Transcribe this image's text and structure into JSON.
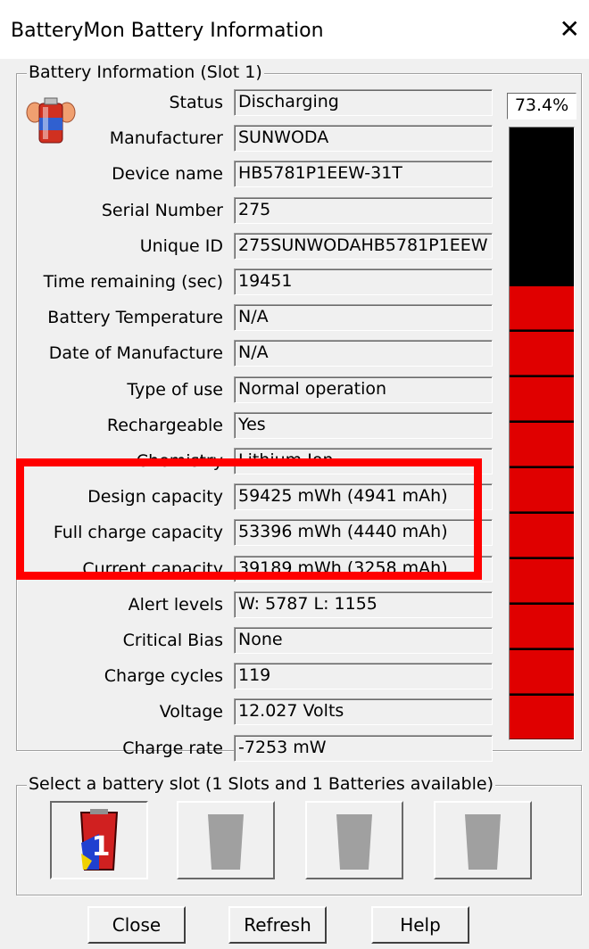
{
  "window": {
    "title": "BatteryMon Battery Information",
    "close_glyph": "✕"
  },
  "info_group": {
    "legend": "Battery Information (Slot 1)",
    "rows": [
      {
        "label": "Status",
        "value": "Discharging"
      },
      {
        "label": "Manufacturer",
        "value": "SUNWODA"
      },
      {
        "label": "Device name",
        "value": "HB5781P1EEW-31T"
      },
      {
        "label": "Serial Number",
        "value": "275"
      },
      {
        "label": "Unique ID",
        "value": "275SUNWODAHB5781P1EEW"
      },
      {
        "label": "Time remaining (sec)",
        "value": "19451"
      },
      {
        "label": "Battery Temperature",
        "value": "N/A"
      },
      {
        "label": "Date of Manufacture",
        "value": "N/A"
      },
      {
        "label": "Type of use",
        "value": "Normal operation"
      },
      {
        "label": "Rechargeable",
        "value": "Yes"
      },
      {
        "label": "Chemistry",
        "value": "Lithium Ion"
      },
      {
        "label": "Design capacity",
        "value": "59425 mWh (4941 mAh)"
      },
      {
        "label": "Full charge capacity",
        "value": "53396 mWh (4440 mAh)"
      },
      {
        "label": "Current capacity",
        "value": "39189 mWh (3258 mAh)"
      },
      {
        "label": "Alert levels",
        "value": "W: 5787 L: 1155"
      },
      {
        "label": "Critical Bias",
        "value": "None"
      },
      {
        "label": "Charge cycles",
        "value": "119"
      },
      {
        "label": "Voltage",
        "value": "12.027 Volts"
      },
      {
        "label": "Charge rate",
        "value": "-7253 mW"
      }
    ],
    "percent_label": "73.4%",
    "level_fraction": 0.734,
    "level_segments": 10,
    "colors": {
      "fill": "#e00000",
      "empty": "#000000",
      "highlight": "#ff0000"
    },
    "icon": "battery-character-icon"
  },
  "slot_group": {
    "legend": "Select a battery slot (1 Slots and 1 Batteries available)",
    "slots": [
      {
        "icon": "battery-slot-1-icon",
        "number": "1",
        "active": true
      },
      {
        "icon": "empty-slot-icon",
        "active": false
      },
      {
        "icon": "empty-slot-icon",
        "active": false
      },
      {
        "icon": "empty-slot-icon",
        "active": false
      }
    ]
  },
  "buttons": {
    "close": "Close",
    "refresh": "Refresh",
    "help": "Help"
  }
}
